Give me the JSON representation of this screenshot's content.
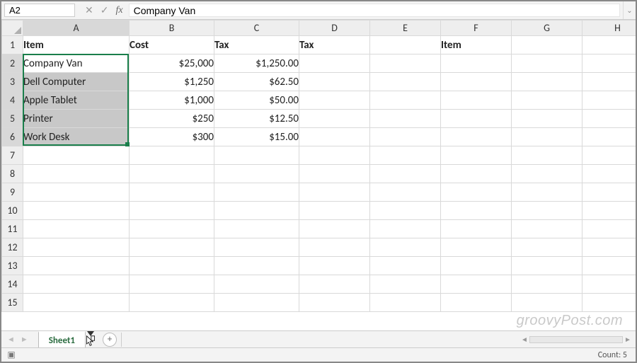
{
  "namebox": {
    "value": "A2"
  },
  "formula": {
    "value": "Company Van"
  },
  "columns": [
    "A",
    "B",
    "C",
    "D",
    "E",
    "F",
    "G",
    "H"
  ],
  "row_numbers": [
    "1",
    "2",
    "3",
    "4",
    "5",
    "6",
    "7",
    "8",
    "9",
    "10",
    "11",
    "12",
    "13",
    "14",
    "15"
  ],
  "headers": {
    "A": "Item",
    "B": "Cost",
    "C": "Tax",
    "D": "Tax",
    "E": "",
    "F": "Item",
    "G": "",
    "H": ""
  },
  "rows": [
    {
      "item": "Company Van",
      "cost": "$25,000",
      "tax": "$1,250.00"
    },
    {
      "item": "Dell Computer",
      "cost": "$1,250",
      "tax": "$62.50"
    },
    {
      "item": "Apple Tablet",
      "cost": "$1,000",
      "tax": "$50.00"
    },
    {
      "item": "Printer",
      "cost": "$250",
      "tax": "$12.50"
    },
    {
      "item": "Work Desk",
      "cost": "$300",
      "tax": "$15.00"
    }
  ],
  "sheet": {
    "name": "Sheet1"
  },
  "status": {
    "count_label": "Count: 5"
  },
  "watermark": "groovyPost.com",
  "selection": {
    "range": "A2:A6",
    "anchor": "A2",
    "count": 5
  },
  "colors": {
    "selection_border": "#1a7f4b",
    "header_bg": "#eeeeee"
  },
  "chart_data": {
    "type": "table",
    "columns": [
      "Item",
      "Cost",
      "Tax"
    ],
    "rows": [
      [
        "Company Van",
        25000,
        1250.0
      ],
      [
        "Dell Computer",
        1250,
        62.5
      ],
      [
        "Apple Tablet",
        1000,
        50.0
      ],
      [
        "Printer",
        250,
        12.5
      ],
      [
        "Work Desk",
        300,
        15.0
      ]
    ],
    "extra_headers": {
      "D1": "Tax",
      "F1": "Item"
    }
  }
}
